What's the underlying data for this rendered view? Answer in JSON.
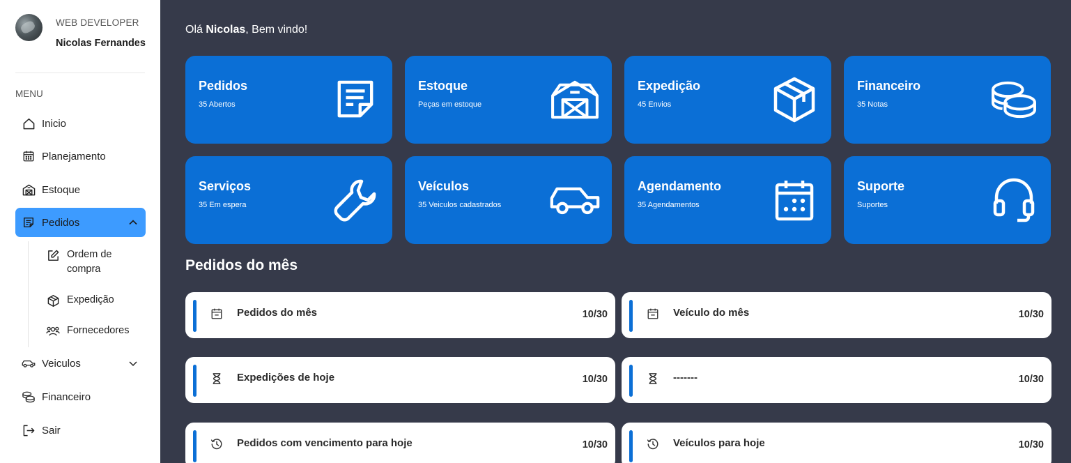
{
  "profile": {
    "role": "WEB DEVELOPER",
    "name": "Nicolas Fernandes"
  },
  "menu": {
    "label": "MENU",
    "items": [
      {
        "label": "Inicio",
        "icon": "home-icon"
      },
      {
        "label": "Planejamento",
        "icon": "calendar-icon"
      },
      {
        "label": "Estoque",
        "icon": "warehouse-icon"
      },
      {
        "label": "Pedidos",
        "icon": "document-icon",
        "active": true,
        "expanded": true
      },
      {
        "label": "Veiculos",
        "icon": "car-icon",
        "expanded": false
      },
      {
        "label": "Financeiro",
        "icon": "coins-icon"
      },
      {
        "label": "Sair",
        "icon": "logout-icon"
      }
    ],
    "pedidos_sub": [
      {
        "label": "Ordem de compra",
        "icon": "edit-icon"
      },
      {
        "label": "Expedição",
        "icon": "box-icon"
      },
      {
        "label": "Fornecedores",
        "icon": "users-icon"
      }
    ]
  },
  "greeting": {
    "prefix": "Olá ",
    "name": "Nicolas",
    "suffix": ", Bem vindo!"
  },
  "cards": [
    {
      "title": "Pedidos",
      "subtitle": "35 Abertos",
      "icon": "document-icon"
    },
    {
      "title": "Estoque",
      "subtitle": "Peças em estoque",
      "icon": "barn-icon"
    },
    {
      "title": "Expedição",
      "subtitle": "45 Envios",
      "icon": "box-icon"
    },
    {
      "title": "Financeiro",
      "subtitle": "35 Notas",
      "icon": "coins-icon"
    },
    {
      "title": "Serviços",
      "subtitle": "35 Em espera",
      "icon": "wrench-icon"
    },
    {
      "title": "Veículos",
      "subtitle": "35 Veiculos cadastrados",
      "icon": "car-icon"
    },
    {
      "title": "Agendamento",
      "subtitle": "35 Agendamentos",
      "icon": "calendar-icon"
    },
    {
      "title": "Suporte",
      "subtitle": "Suportes",
      "icon": "headset-icon"
    }
  ],
  "section_title": "Pedidos do mês",
  "stats": [
    {
      "label": "Pedidos do mês",
      "value": "10/30",
      "icon": "calendar-icon"
    },
    {
      "label": "Veículo do mês",
      "value": "10/30",
      "icon": "calendar-icon"
    },
    {
      "label": "Expedições de hoje",
      "value": "10/30",
      "icon": "hourglass-icon"
    },
    {
      "label": "-------",
      "value": "10/30",
      "icon": "hourglass-icon"
    },
    {
      "label": "Pedidos com vencimento para hoje",
      "value": "10/30",
      "icon": "clock-icon"
    },
    {
      "label": "Veículos para hoje",
      "value": "10/30",
      "icon": "clock-icon"
    }
  ],
  "colors": {
    "accent": "#0b6fd6",
    "active_nav": "#3d9bff",
    "background": "#363a4a",
    "sidebar": "#ffffff"
  }
}
